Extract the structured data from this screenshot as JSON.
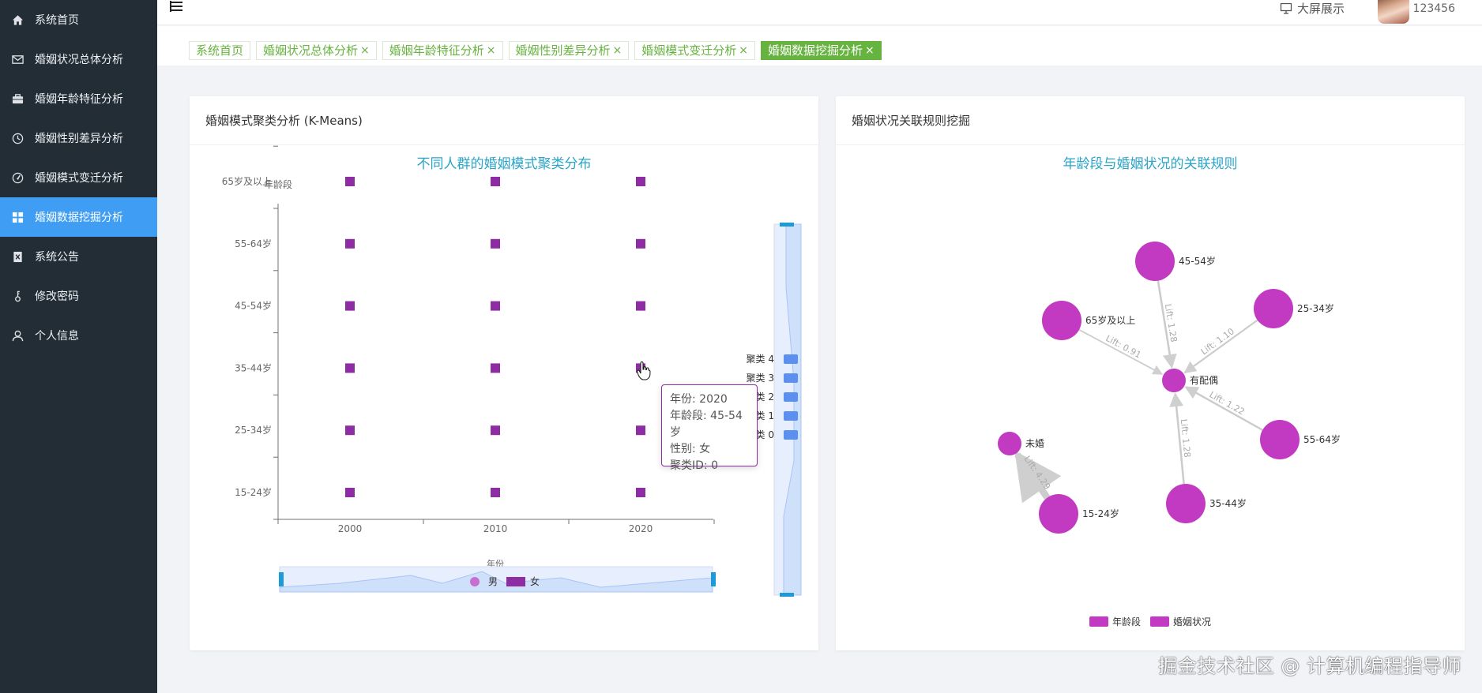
{
  "sidebar": {
    "items": [
      {
        "label": "系统首页",
        "icon": "home-icon",
        "active": false
      },
      {
        "label": "婚姻状况总体分析",
        "icon": "mail-icon",
        "active": false
      },
      {
        "label": "婚姻年龄特征分析",
        "icon": "briefcase-icon",
        "active": false
      },
      {
        "label": "婚姻性别差异分析",
        "icon": "clock-icon",
        "active": false
      },
      {
        "label": "婚姻模式变迁分析",
        "icon": "gauge-icon",
        "active": false
      },
      {
        "label": "婚姻数据挖掘分析",
        "icon": "grid-icon",
        "active": true
      },
      {
        "label": "系统公告",
        "icon": "notice-icon",
        "active": false
      },
      {
        "label": "修改密码",
        "icon": "key-icon",
        "active": false
      },
      {
        "label": "个人信息",
        "icon": "user-icon",
        "active": false
      }
    ]
  },
  "header": {
    "big_screen_label": "大屏展示",
    "username": "123456"
  },
  "tabs": [
    {
      "label": "系统首页",
      "closable": false,
      "active": false
    },
    {
      "label": "婚姻状况总体分析",
      "closable": true,
      "active": false
    },
    {
      "label": "婚姻年龄特征分析",
      "closable": true,
      "active": false
    },
    {
      "label": "婚姻性别差异分析",
      "closable": true,
      "active": false
    },
    {
      "label": "婚姻模式变迁分析",
      "closable": true,
      "active": false
    },
    {
      "label": "婚姻数据挖掘分析",
      "closable": true,
      "active": true
    }
  ],
  "tab_close_glyph": "×",
  "colors": {
    "accent": "#3f9ef3",
    "tab_green": "#67b340",
    "chart_title": "#2aa4c9",
    "scatter_point": "#8e2ca3",
    "node": "#c23ac2",
    "visualmap_block": "#5b8ff0",
    "edge": "#cccccc"
  },
  "left_panel": {
    "title": "婚姻模式聚类分析 (K-Means)",
    "chart_data": {
      "type": "scatter",
      "title": "不同人群的婚姻模式聚类分布",
      "xlabel": "年份",
      "ylabel": "年龄段",
      "x_categories": [
        "2000",
        "2010",
        "2020"
      ],
      "y_categories": [
        "15-24岁",
        "25-34岁",
        "35-44岁",
        "45-54岁",
        "55-64岁",
        "65岁及以上"
      ],
      "series": [
        {
          "name": "男",
          "symbol": "circle"
        },
        {
          "name": "女",
          "symbol": "rect"
        }
      ],
      "points": [
        {
          "x": "2000",
          "y": "15-24岁"
        },
        {
          "x": "2010",
          "y": "15-24岁"
        },
        {
          "x": "2020",
          "y": "15-24岁"
        },
        {
          "x": "2000",
          "y": "25-34岁"
        },
        {
          "x": "2010",
          "y": "25-34岁"
        },
        {
          "x": "2020",
          "y": "25-34岁"
        },
        {
          "x": "2000",
          "y": "35-44岁"
        },
        {
          "x": "2010",
          "y": "35-44岁"
        },
        {
          "x": "2020",
          "y": "35-44岁"
        },
        {
          "x": "2000",
          "y": "45-54岁"
        },
        {
          "x": "2010",
          "y": "45-54岁"
        },
        {
          "x": "2020",
          "y": "45-54岁"
        },
        {
          "x": "2000",
          "y": "55-64岁"
        },
        {
          "x": "2010",
          "y": "55-64岁"
        },
        {
          "x": "2020",
          "y": "55-64岁"
        },
        {
          "x": "2000",
          "y": "65岁及以上"
        },
        {
          "x": "2010",
          "y": "65岁及以上"
        },
        {
          "x": "2020",
          "y": "65岁及以上"
        }
      ],
      "visual_map": [
        "聚类 4",
        "聚类 3",
        "聚类 2",
        "聚类 1",
        "聚类 0"
      ],
      "tooltip": {
        "lines": [
          "年份: 2020",
          "年龄段: 45-54岁",
          "性别: 女",
          "聚类ID: 0"
        ]
      }
    }
  },
  "right_panel": {
    "title": "婚姻状况关联规则挖掘",
    "chart_data": {
      "type": "graph",
      "title": "年龄段与婚姻状况的关联规则",
      "legend": [
        "年龄段",
        "婚姻状况"
      ],
      "nodes": [
        {
          "name": "45-54岁",
          "category": "年龄段"
        },
        {
          "name": "25-34岁",
          "category": "年龄段"
        },
        {
          "name": "65岁及以上",
          "category": "年龄段"
        },
        {
          "name": "有配偶",
          "category": "婚姻状况"
        },
        {
          "name": "55-64岁",
          "category": "年龄段"
        },
        {
          "name": "未婚",
          "category": "婚姻状况"
        },
        {
          "name": "15-24岁",
          "category": "年龄段"
        },
        {
          "name": "35-44岁",
          "category": "年龄段"
        }
      ],
      "edges": [
        {
          "source": "45-54岁",
          "target": "有配偶",
          "label": "Lift: 1.28",
          "lift": 1.28
        },
        {
          "source": "25-34岁",
          "target": "有配偶",
          "label": "Lift: 1.10",
          "lift": 1.1
        },
        {
          "source": "65岁及以上",
          "target": "有配偶",
          "label": "Lift: 0.91",
          "lift": 0.91
        },
        {
          "source": "55-64岁",
          "target": "有配偶",
          "label": "Lift: 1.22",
          "lift": 1.22
        },
        {
          "source": "35-44岁",
          "target": "有配偶",
          "label": "Lift: 1.28",
          "lift": 1.28
        },
        {
          "source": "15-24岁",
          "target": "未婚",
          "label": "Lift: 4.29",
          "lift": 4.29
        }
      ]
    }
  },
  "watermark": "掘金技术社区 @ 计算机编程指导师"
}
